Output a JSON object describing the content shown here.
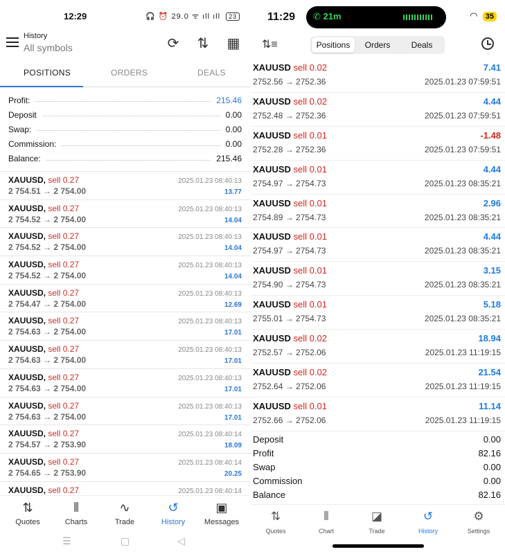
{
  "android": {
    "status": {
      "time": "12:29",
      "icons": "🎧 ⏰ 29.0 ᯤ ıll ıll",
      "battery": "23"
    },
    "toolbar": {
      "title": "History",
      "subtitle": "All symbols"
    },
    "tabs": [
      "POSITIONS",
      "ORDERS",
      "DEALS"
    ],
    "summary": [
      {
        "label": "Profit:",
        "value": "215.46"
      },
      {
        "label": "Deposit",
        "value": "0.00"
      },
      {
        "label": "Swap:",
        "value": "0.00"
      },
      {
        "label": "Commission:",
        "value": "0.00"
      },
      {
        "label": "Balance:",
        "value": "215.46"
      }
    ],
    "deals": [
      {
        "symbol": "XAUUSD,",
        "side": "sell 0.27",
        "prices": "2 754.51 → 2 754.00",
        "time": "2025.01.23 08:40:13",
        "profit": "13.77"
      },
      {
        "symbol": "XAUUSD,",
        "side": "sell 0.27",
        "prices": "2 754.52 → 2 754.00",
        "time": "2025.01.23 08:40:13",
        "profit": "14.04"
      },
      {
        "symbol": "XAUUSD,",
        "side": "sell 0.27",
        "prices": "2 754.52 → 2 754.00",
        "time": "2025.01.23 08:40:13",
        "profit": "14.04"
      },
      {
        "symbol": "XAUUSD,",
        "side": "sell 0.27",
        "prices": "2 754.52 → 2 754.00",
        "time": "2025.01.23 08:40:13",
        "profit": "14.04"
      },
      {
        "symbol": "XAUUSD,",
        "side": "sell 0.27",
        "prices": "2 754.47 → 2 754.00",
        "time": "2025.01.23 08:40:13",
        "profit": "12.69"
      },
      {
        "symbol": "XAUUSD,",
        "side": "sell 0.27",
        "prices": "2 754.63 → 2 754.00",
        "time": "2025.01.23 08:40:13",
        "profit": "17.01"
      },
      {
        "symbol": "XAUUSD,",
        "side": "sell 0.27",
        "prices": "2 754.63 → 2 754.00",
        "time": "2025.01.23 08:40:13",
        "profit": "17.01"
      },
      {
        "symbol": "XAUUSD,",
        "side": "sell 0.27",
        "prices": "2 754.63 → 2 754.00",
        "time": "2025.01.23 08:40:13",
        "profit": "17.01"
      },
      {
        "symbol": "XAUUSD,",
        "side": "sell 0.27",
        "prices": "2 754.63 → 2 754.00",
        "time": "2025.01.23 08:40:13",
        "profit": "17.01"
      },
      {
        "symbol": "XAUUSD,",
        "side": "sell 0.27",
        "prices": "2 754.57 → 2 753.90",
        "time": "2025.01.23 08:40:14",
        "profit": "18.09"
      },
      {
        "symbol": "XAUUSD,",
        "side": "sell 0.27",
        "prices": "2 754.65 → 2 753.90",
        "time": "2025.01.23 08:40:14",
        "profit": "20.25"
      },
      {
        "symbol": "XAUUSD,",
        "side": "sell 0.27",
        "prices": "",
        "time": "2025.01.23 08:40:14",
        "profit": ""
      }
    ],
    "nav": [
      "Quotes",
      "Charts",
      "Trade",
      "History",
      "Messages"
    ],
    "nav_active": 3
  },
  "ios": {
    "status": {
      "time": "11:29",
      "call": "21m",
      "battery": "35"
    },
    "segments": [
      "Positions",
      "Orders",
      "Deals"
    ],
    "deals": [
      {
        "symbol": "XAUUSD",
        "side": "sell 0.02",
        "prices": "2752.56 → 2752.36",
        "time": "2025.01.23 07:59:51",
        "profit": "7.41",
        "color": "#1e7be0"
      },
      {
        "symbol": "XAUUSD",
        "side": "sell 0.02",
        "prices": "2752.48 → 2752.36",
        "time": "2025.01.23 07:59:51",
        "profit": "4.44",
        "color": "#1e7be0"
      },
      {
        "symbol": "XAUUSD",
        "side": "sell 0.01",
        "prices": "2752.28 → 2752.36",
        "time": "2025.01.23 07:59:51",
        "profit": "-1.48",
        "color": "#d4241d"
      },
      {
        "symbol": "XAUUSD",
        "side": "sell 0.01",
        "prices": "2754.97 → 2754.73",
        "time": "2025.01.23 08:35:21",
        "profit": "4.44",
        "color": "#1e7be0"
      },
      {
        "symbol": "XAUUSD",
        "side": "sell 0.01",
        "prices": "2754.89 → 2754.73",
        "time": "2025.01.23 08:35:21",
        "profit": "2.96",
        "color": "#1e7be0"
      },
      {
        "symbol": "XAUUSD",
        "side": "sell 0.01",
        "prices": "2754.97 → 2754.73",
        "time": "2025.01.23 08:35:21",
        "profit": "4.44",
        "color": "#1e7be0"
      },
      {
        "symbol": "XAUUSD",
        "side": "sell 0.01",
        "prices": "2754.90 → 2754.73",
        "time": "2025.01.23 08:35:21",
        "profit": "3.15",
        "color": "#1e7be0"
      },
      {
        "symbol": "XAUUSD",
        "side": "sell 0.01",
        "prices": "2755.01 → 2754.73",
        "time": "2025.01.23 08:35:21",
        "profit": "5.18",
        "color": "#1e7be0"
      },
      {
        "symbol": "XAUUSD",
        "side": "sell 0.02",
        "prices": "2752.57 → 2752.06",
        "time": "2025.01.23 11:19:15",
        "profit": "18.94",
        "color": "#1e7be0"
      },
      {
        "symbol": "XAUUSD",
        "side": "sell 0.02",
        "prices": "2752.64 → 2752.06",
        "time": "2025.01.23 11:19:15",
        "profit": "21.54",
        "color": "#1e7be0"
      },
      {
        "symbol": "XAUUSD",
        "side": "sell 0.01",
        "prices": "2752.66 → 2752.06",
        "time": "2025.01.23 11:19:15",
        "profit": "11.14",
        "color": "#1e7be0"
      }
    ],
    "summary": [
      {
        "label": "Deposit",
        "value": "0.00"
      },
      {
        "label": "Profit",
        "value": "82.16"
      },
      {
        "label": "Swap",
        "value": "0.00"
      },
      {
        "label": "Commission",
        "value": "0.00"
      },
      {
        "label": "Balance",
        "value": "82.16"
      }
    ],
    "tabs": [
      "Quotes",
      "Chart",
      "Trade",
      "History",
      "Settings"
    ],
    "tab_active": 3
  },
  "colors": {
    "accent": "#2c76d8",
    "sell": "#c9302c",
    "negative": "#d4241d"
  }
}
